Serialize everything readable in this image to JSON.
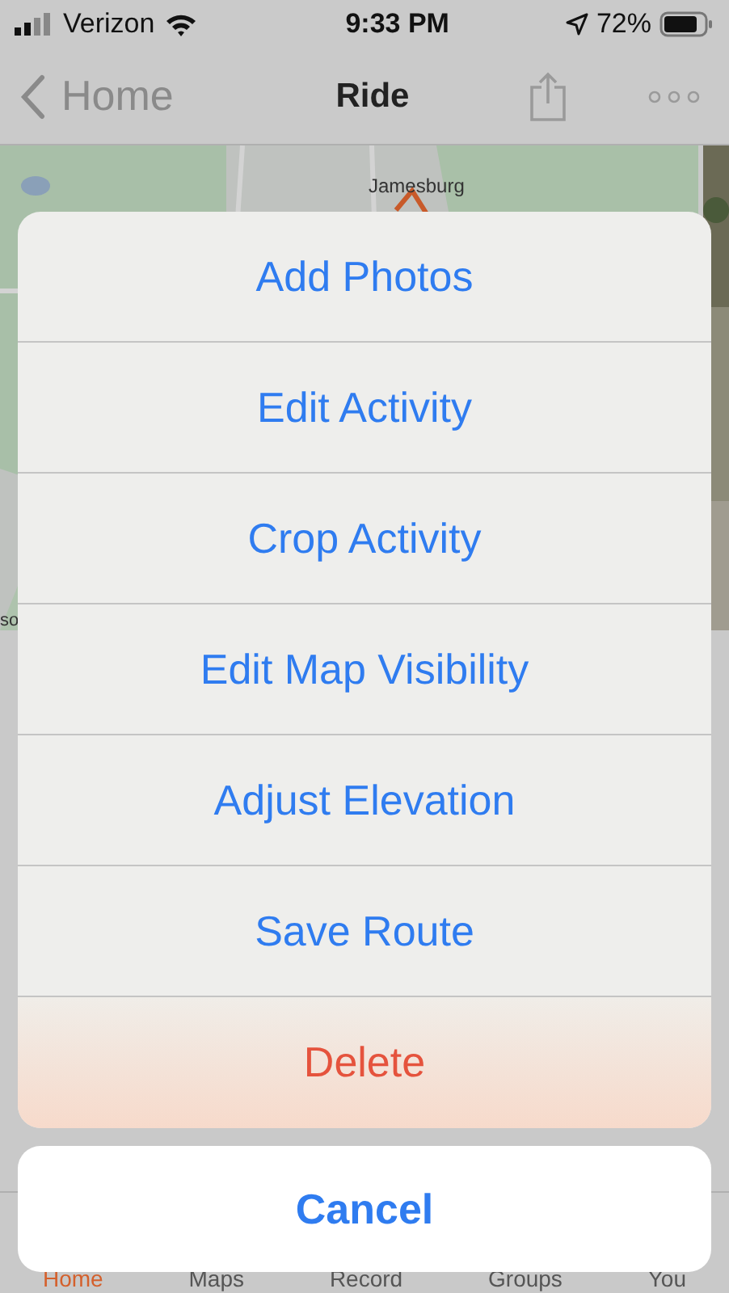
{
  "status_bar": {
    "carrier": "Verizon",
    "time": "9:33 PM",
    "battery": "72%"
  },
  "nav_bar": {
    "back": "Home",
    "title": "Ride"
  },
  "map": {
    "label": "Jamesburg",
    "label_2": "so"
  },
  "action_sheet": {
    "actions": [
      {
        "label": "Add Photos",
        "kind": "default"
      },
      {
        "label": "Edit Activity",
        "kind": "default"
      },
      {
        "label": "Crop Activity",
        "kind": "default"
      },
      {
        "label": "Edit Map Visibility",
        "kind": "default"
      },
      {
        "label": "Adjust Elevation",
        "kind": "default"
      },
      {
        "label": "Save Route",
        "kind": "default"
      },
      {
        "label": "Delete",
        "kind": "destructive"
      }
    ],
    "cancel": "Cancel"
  },
  "tab_bar": [
    {
      "label": "Home",
      "selected": true
    },
    {
      "label": "Maps",
      "selected": false
    },
    {
      "label": "Record",
      "selected": false
    },
    {
      "label": "Groups",
      "selected": false
    },
    {
      "label": "You",
      "selected": false
    }
  ]
}
